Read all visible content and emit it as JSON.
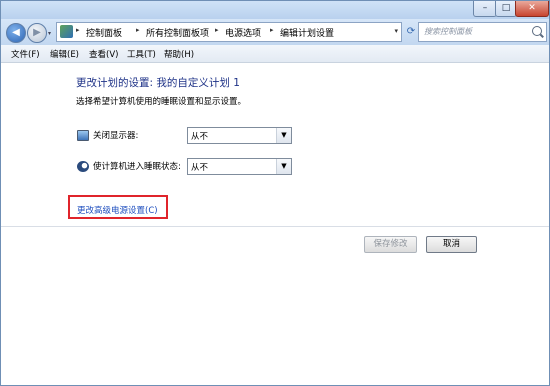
{
  "window": {
    "minimize_glyph": "–",
    "maximize_glyph": "□",
    "close_glyph": "✕"
  },
  "nav": {
    "back_glyph": "◀",
    "forward_glyph": "▶",
    "dropdown_glyph": "▾",
    "breadcrumb_sep": "▸",
    "breadcrumbs": [
      "控制面板",
      "所有控制面板项",
      "电源选项",
      "编辑计划设置"
    ],
    "refresh_glyph": "⟳",
    "address_dropdown_glyph": "▾",
    "search_placeholder": "搜索控制面板"
  },
  "menu": [
    "文件(F)",
    "编辑(E)",
    "查看(V)",
    "工具(T)",
    "帮助(H)"
  ],
  "page": {
    "title": "更改计划的设置: 我的自定义计划 1",
    "subtitle": "选择希望计算机使用的睡眠设置和显示设置。"
  },
  "settings": [
    {
      "icon": "monitor-icon",
      "label": "关闭显示器:",
      "value": "从不"
    },
    {
      "icon": "sleep-icon",
      "label": "使计算机进入睡眠状态:",
      "value": "从不"
    }
  ],
  "select_arrow_glyph": "▼",
  "advanced_link": "更改高级电源设置(C)",
  "buttons": {
    "save": "保存修改",
    "cancel": "取消"
  },
  "colors": {
    "title_blue": "#1e3287",
    "link_blue": "#1f4fbf",
    "highlight_red": "#e0242b"
  }
}
